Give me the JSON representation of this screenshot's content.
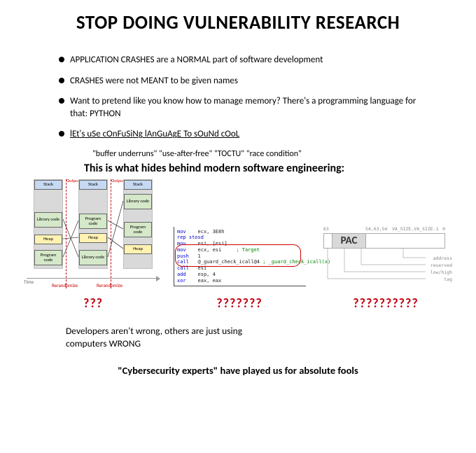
{
  "title": "STOP DOING VULNERABILITY RESEARCH",
  "bullets": [
    "APPLICATION CRASHES are a NORMAL part of software development",
    "CRASHES were not MEANT to be given names",
    " Want to pretend like you know how to manage memory? There's a programming language for that: PYTHON"
  ],
  "mocking_line": "lEt's uSe cOnFuSiNg lAnGuAgE To sOuNd cOoL",
  "quote_terms": "\"buffer underruns\" \"use-after-free\" \"TOCTU\" \"race condition\"",
  "subheading": "This is what hides behind modern software engineering:",
  "qmarks": {
    "a": "???",
    "b": "???????",
    "c": "??????????"
  },
  "diagram1": {
    "segments": [
      "Stack",
      "Library code",
      "Heap",
      "Program code"
    ],
    "output_label": "Output",
    "rerandomize_label": "Rerandomize",
    "time_label": "Time"
  },
  "diagram2": {
    "lines": [
      {
        "op": "mov",
        "args": "ecx, 3E8h"
      },
      {
        "op": "rep stosd",
        "args": ""
      },
      {
        "op": "mov",
        "args": "esi, [esi]"
      },
      {
        "op": "mov",
        "args": "ecx, esi",
        "cmt": "; Target"
      },
      {
        "op": "push",
        "args": "1"
      },
      {
        "op": "call",
        "args": "@_guard_check_icall@4",
        "cmt": "; _guard_check_icall(x)"
      },
      {
        "op": "call",
        "args": "esi"
      },
      {
        "op": "add",
        "args": "esp, 4"
      },
      {
        "op": "xor",
        "args": "eax, eax"
      }
    ]
  },
  "diagram3": {
    "bits_left": "63",
    "bits_mid": "54,63,54",
    "bits_v": "VA_SIZE,VA_SIZE-1",
    "bits_right": "0",
    "pac_label": "PAC",
    "leads": [
      "address",
      "reserved",
      "low/high",
      "tag"
    ]
  },
  "outro1": "Developers aren't wrong, others are just using computers WRONG",
  "outro2": "\"Cybersecurity experts\" have played us for absolute fools"
}
